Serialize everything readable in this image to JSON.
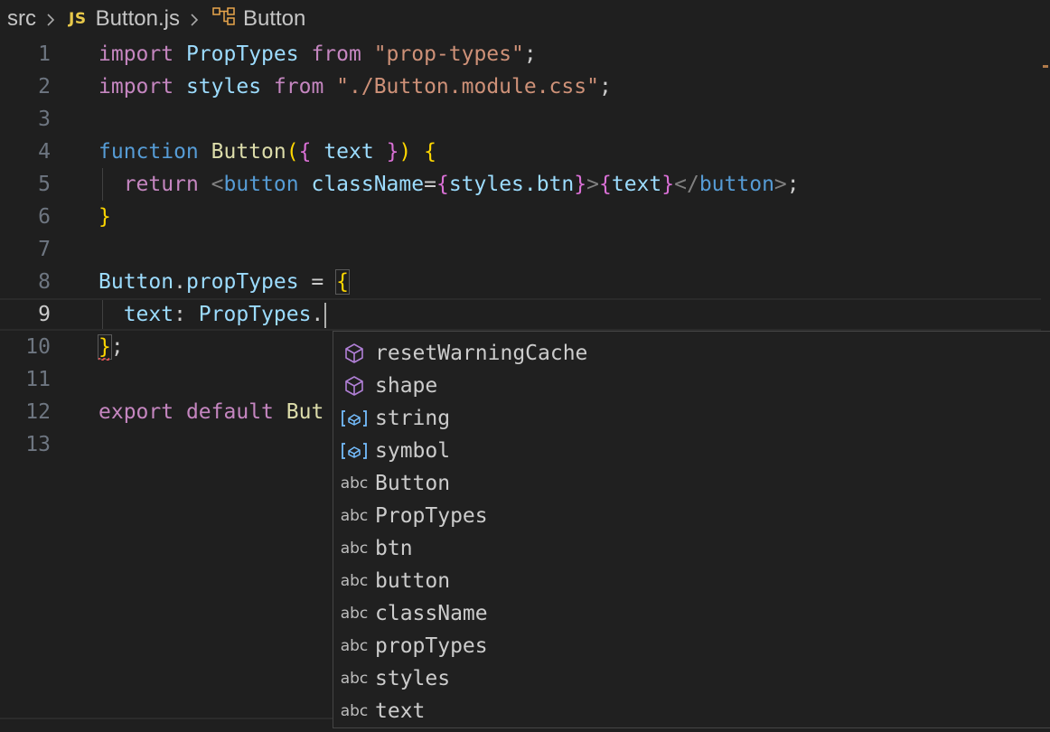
{
  "breadcrumb": {
    "folder": "src",
    "file_badge": "JS",
    "file": "Button.js",
    "symbol": "Button"
  },
  "editor": {
    "line_numbers": [
      "1",
      "2",
      "3",
      "4",
      "5",
      "6",
      "7",
      "8",
      "9",
      "10",
      "11",
      "12",
      "13"
    ],
    "active_line": 9
  },
  "code": {
    "l1": {
      "import": "import",
      "PropTypes": "PropTypes",
      "from": "from",
      "str": "\"prop-types\"",
      "semi": ";"
    },
    "l2": {
      "import": "import",
      "styles": "styles",
      "from": "from",
      "str": "\"./Button.module.css\"",
      "semi": ";"
    },
    "l4": {
      "function": "function",
      "name": "Button",
      "open_paren": "(",
      "open_brace": "{",
      "param": "text",
      "close_brace": "}",
      "close_paren": ")",
      "body_brace": "{"
    },
    "l5": {
      "return": "return",
      "lt": "<",
      "tag": "button",
      "attr": "className",
      "eq": "=",
      "ob1": "{",
      "expr": "styles.btn",
      "cb1": "}",
      "gt": ">",
      "ob2": "{",
      "text": "text",
      "cb2": "}",
      "close": "</",
      "tag2": "button",
      "gt2": ">",
      "semi": ";"
    },
    "l6": {
      "brace": "}"
    },
    "l8": {
      "obj": "Button",
      "dot": ".",
      "prop": "propTypes",
      "eq": " = ",
      "brace": "{"
    },
    "l9": {
      "key": "text",
      "colon": ": ",
      "obj": "PropTypes",
      "dot": "."
    },
    "l10": {
      "brace": "}",
      "semi": ";"
    },
    "l12": {
      "export": "export",
      "default": "default",
      "partial": "But"
    }
  },
  "suggest": {
    "items": [
      {
        "icon": "cube-icon",
        "label": "resetWarningCache"
      },
      {
        "icon": "cube-icon",
        "label": "shape"
      },
      {
        "icon": "variable-icon",
        "label": "string"
      },
      {
        "icon": "variable-icon",
        "label": "symbol"
      },
      {
        "icon": "abc",
        "label": "Button"
      },
      {
        "icon": "abc",
        "label": "PropTypes"
      },
      {
        "icon": "abc",
        "label": "btn"
      },
      {
        "icon": "abc",
        "label": "button"
      },
      {
        "icon": "abc",
        "label": "className"
      },
      {
        "icon": "abc",
        "label": "propTypes"
      },
      {
        "icon": "abc",
        "label": "styles"
      },
      {
        "icon": "abc",
        "label": "text"
      }
    ],
    "abc_text": "abc"
  },
  "colors": {
    "background": "#1f1f1f",
    "keyword": "#c586c0",
    "declaration": "#569cd6",
    "function": "#dcdcaa",
    "variable": "#9cdcfe",
    "string": "#ce9178",
    "bracket_1": "#ffd700",
    "bracket_2": "#da70d6",
    "bracket_3": "#179fff",
    "suggest_symbol_icon": "#b180d7",
    "suggest_variable_icon": "#75beff"
  }
}
